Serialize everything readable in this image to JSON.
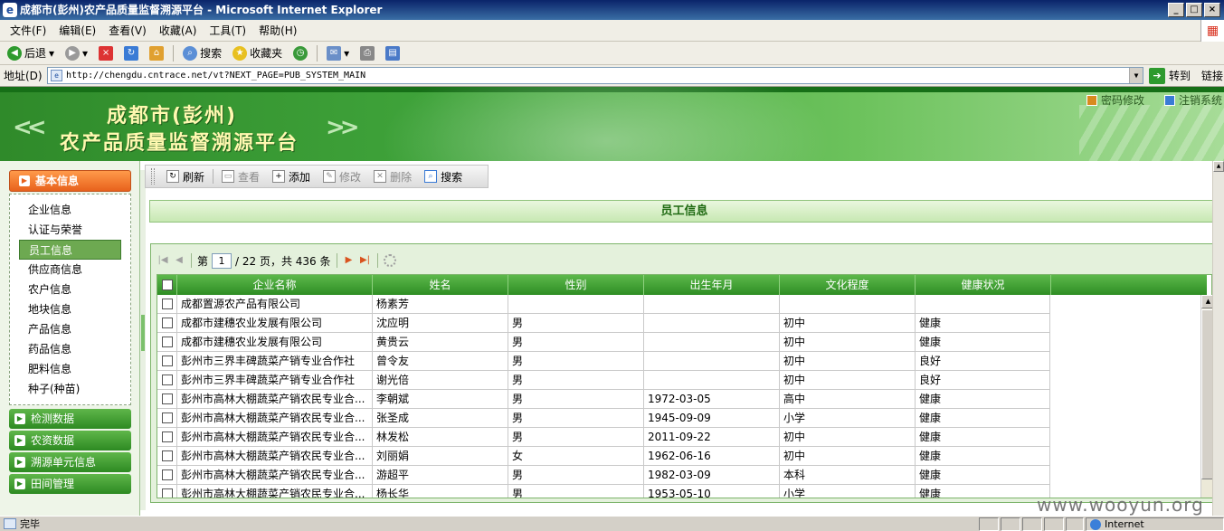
{
  "window": {
    "title": "成都市(彭州)农产品质量监督溯源平台 - Microsoft Internet Explorer"
  },
  "menu": [
    "文件(F)",
    "编辑(E)",
    "查看(V)",
    "收藏(A)",
    "工具(T)",
    "帮助(H)"
  ],
  "toolbar": {
    "back": "后退",
    "search": "搜索",
    "favorites": "收藏夹"
  },
  "address": {
    "label": "地址(D)",
    "url": "http://chengdu.cntrace.net/vt?NEXT_PAGE=PUB_SYSTEM_MAIN",
    "go": "转到",
    "links": "链接"
  },
  "banner": {
    "title_line1": "成都市(彭州)",
    "title_line2": "农产品质量监督溯源平台",
    "change_password": "密码修改",
    "logout": "注销系统"
  },
  "sidebar": {
    "active_section": "基本信息",
    "items": [
      "企业信息",
      "认证与荣誉",
      "员工信息",
      "供应商信息",
      "农户信息",
      "地块信息",
      "产品信息",
      "药品信息",
      "肥料信息",
      "种子(种苗)"
    ],
    "selected_item": "员工信息",
    "sections": [
      "检测数据",
      "农资数据",
      "溯源单元信息",
      "田间管理"
    ]
  },
  "actions": {
    "refresh": "刷新",
    "view": "查看",
    "add": "添加",
    "edit": "修改",
    "delete": "删除",
    "search": "搜索"
  },
  "section_title": "员工信息",
  "pager": {
    "prefix": "第",
    "page": "1",
    "suffix": "/ 22 页，共 436 条"
  },
  "table": {
    "headers": [
      "企业名称",
      "姓名",
      "性别",
      "出生年月",
      "文化程度",
      "健康状况"
    ],
    "rows": [
      [
        "成都置源农产品有限公司",
        "杨素芳",
        "",
        "",
        "",
        ""
      ],
      [
        "成都市建穗农业发展有限公司",
        "沈应明",
        "男",
        "",
        "初中",
        "健康"
      ],
      [
        "成都市建穗农业发展有限公司",
        "黄贵云",
        "男",
        "",
        "初中",
        "健康"
      ],
      [
        "彭州市三界丰碑蔬菜产销专业合作社",
        "曾令友",
        "男",
        "",
        "初中",
        "良好"
      ],
      [
        "彭州市三界丰碑蔬菜产销专业合作社",
        "谢光倍",
        "男",
        "",
        "初中",
        "良好"
      ],
      [
        "彭州市高林大棚蔬菜产销农民专业合...",
        "李朝斌",
        "男",
        "1972-03-05",
        "高中",
        "健康"
      ],
      [
        "彭州市高林大棚蔬菜产销农民专业合...",
        "张圣成",
        "男",
        "1945-09-09",
        "小学",
        "健康"
      ],
      [
        "彭州市高林大棚蔬菜产销农民专业合...",
        "林发松",
        "男",
        "2011-09-22",
        "初中",
        "健康"
      ],
      [
        "彭州市高林大棚蔬菜产销农民专业合...",
        "刘丽娟",
        "女",
        "1962-06-16",
        "初中",
        "健康"
      ],
      [
        "彭州市高林大棚蔬菜产销农民专业合...",
        "游超平",
        "男",
        "1982-03-09",
        "本科",
        "健康"
      ],
      [
        "彭州市高林大棚蔬菜产销农民专业合...",
        "杨长华",
        "男",
        "1953-05-10",
        "小学",
        "健康"
      ]
    ]
  },
  "status": {
    "text": "完毕",
    "zone": "Internet"
  },
  "watermark": "www.wooyun.org"
}
